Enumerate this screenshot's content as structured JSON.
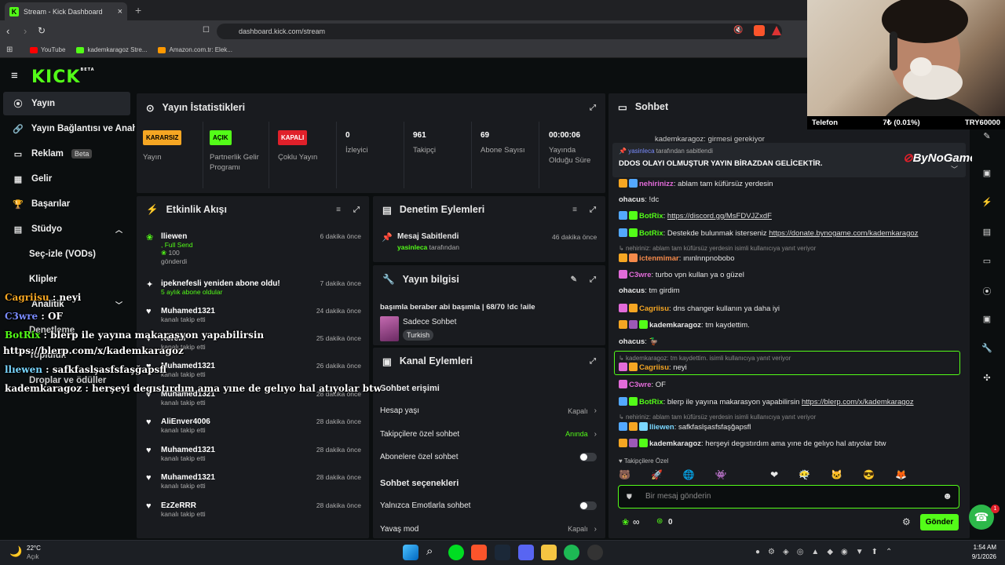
{
  "browser": {
    "tab_title": "Stream - Kick Dashboard",
    "url": "dashboard.kick.com/stream",
    "bookmarks": [
      {
        "label": "YouTube",
        "color": "#ff0000"
      },
      {
        "label": "kademkaragoz Stre...",
        "color": "#53fc18"
      },
      {
        "label": "Amazon.com.tr: Elek...",
        "color": "#ff9900"
      }
    ]
  },
  "kick": {
    "logo": "KICK",
    "logo_sup": "BETA"
  },
  "sidebar": {
    "items": [
      {
        "label": "Yayın",
        "icon": "radio-icon"
      },
      {
        "label": "Yayın Bağlantısı ve Anahtarı",
        "icon": "link-icon"
      },
      {
        "label": "Reklam",
        "icon": "ad-icon",
        "badge": "Beta"
      },
      {
        "label": "Gelir",
        "icon": "money-icon"
      },
      {
        "label": "Başarılar",
        "icon": "trophy-icon"
      },
      {
        "label": "Stüdyo",
        "icon": "studio-icon"
      }
    ],
    "studio_sub": [
      "Seç-izle (VODs)",
      "Klipler"
    ],
    "analytics": "Analitik",
    "hidden": [
      "Denetleme",
      "Topluluk",
      "Droplar ve ödüller"
    ]
  },
  "stats": {
    "title": "Yayın İstatistikleri",
    "cards": [
      {
        "badge": "KARARSIZ",
        "label": "Yayın",
        "color": "#f5a623",
        "text": "#000"
      },
      {
        "badge": "AÇIK",
        "label": "Partnerlik Gelir Programı",
        "color": "#53fc18",
        "text": "#000"
      },
      {
        "badge": "KAPALI",
        "label": "Çoklu Yayın",
        "color": "#e0202a",
        "text": "#fff"
      }
    ],
    "numbers": [
      {
        "value": "0",
        "label": "İzleyici"
      },
      {
        "value": "961",
        "label": "Takipçi"
      },
      {
        "value": "69",
        "label": "Abone Sayısı"
      },
      {
        "value": "00:00:06",
        "label": "Yayında Olduğu Süre"
      }
    ]
  },
  "activity": {
    "title": "Etkinlik Akışı",
    "events": [
      {
        "title": "lliewen",
        "sub": ", Full Send",
        "extra": "100",
        "extra2": "gönderdi",
        "time": "6 dakika önce",
        "icon": "kicks-icon"
      },
      {
        "title": "ipeknefesli yeniden abone oldu!",
        "sub": "5 aylık abone oldular",
        "time": "7 dakika önce",
        "icon": "star-icon"
      },
      {
        "title": "Muhamed1321",
        "sub": "kanalı takip etti",
        "time": "24 dakika önce",
        "icon": "heart-icon"
      },
      {
        "title": "Kerem",
        "sub": "kanalı takip etti",
        "time": "25 dakika önce",
        "icon": "heart-icon"
      },
      {
        "title": "Muhamed1321",
        "sub": "kanalı takip etti",
        "time": "26 dakika önce",
        "icon": "heart-icon"
      },
      {
        "title": "Muhamed1321",
        "sub": "kanalı takip etti",
        "time": "28 dakika önce",
        "icon": "heart-icon"
      },
      {
        "title": "AliEnver4006",
        "sub": "kanalı takip etti",
        "time": "28 dakika önce",
        "icon": "heart-icon"
      },
      {
        "title": "Muhamed1321",
        "sub": "kanalı takip etti",
        "time": "28 dakika önce",
        "icon": "heart-icon"
      },
      {
        "title": "Muhamed1321",
        "sub": "kanalı takip etti",
        "time": "28 dakika önce",
        "icon": "heart-icon"
      },
      {
        "title": "EzZeRRR",
        "sub": "kanalı takip etti",
        "time": "28 dakika önce",
        "icon": "heart-icon"
      }
    ]
  },
  "moderation": {
    "title": "Denetim Eylemleri",
    "event": {
      "title": "Mesaj Sabitlendi",
      "user": "yasinleca",
      "suffix": "tarafından",
      "time": "46 dakika önce"
    }
  },
  "streaminfo": {
    "title": "Yayın bilgisi",
    "stream_title": "başımla beraber abi başımla | 68/70 !dc !aile",
    "category": "Sadece Sohbet",
    "tag": "Turkish"
  },
  "channel": {
    "title": "Kanal Eylemleri",
    "section1": "Sohbet erişimi",
    "rows1": [
      {
        "label": "Hesap yaşı",
        "value": "Kapalı",
        "type": "link"
      },
      {
        "label": "Takipçilere özel sohbet",
        "value": "Anında",
        "type": "link"
      },
      {
        "label": "Abonelere özel sohbet",
        "value": "",
        "type": "toggle"
      }
    ],
    "section2": "Sohbet seçenekleri",
    "rows2": [
      {
        "label": "Yalnızca Emotlarla sohbet",
        "value": "",
        "type": "toggle"
      },
      {
        "label": "Yavaş mod",
        "value": "Kapalı",
        "type": "link"
      }
    ]
  },
  "chat": {
    "title": "Sohbet",
    "pinned": {
      "by": "yasinleca",
      "by_suffix": "tarafından sabitlendi",
      "text": "DDOS OLAYI OLMUŞTUR YAYIN BİRAZDAN GELİCEKTİR."
    },
    "top_partial": "kademkaragoz: girmesi gerekiyor",
    "messages": [
      {
        "user": "nehirinizz",
        "color": "#e26bd9",
        "text": ": ablam tam küfürsüz yerdesin"
      },
      {
        "user": "ohacus",
        "color": "#e8e8e8",
        "text": ": !dc"
      },
      {
        "user": "BotRix",
        "color": "#53fc18",
        "text": ": ",
        "link": "https://discord.gg/MsFDVJZxdF"
      },
      {
        "user": "BotRix",
        "color": "#53fc18",
        "text": ": Destekde bulunmak isterseniz ",
        "link": "https://donate.bynogame.com/kademkaragoz"
      },
      {
        "user": "ictenmimar",
        "color": "#f58a4b",
        "text": ": ınınlnnpnobobo"
      },
      {
        "user": "C3wre",
        "color": "#e26bd9",
        "text": ": turbo vpn kullan ya o güzel"
      },
      {
        "user": "ohacus",
        "color": "#e8e8e8",
        "text": ": tm girdim"
      },
      {
        "user": "Cagriisu",
        "color": "#f5a623",
        "text": ": dns changer kullanın ya daha iyi"
      },
      {
        "user": "kademkaragoz",
        "color": "#e8e8e8",
        "text": ": tm kaydettim."
      },
      {
        "user": "ohacus",
        "color": "#e8e8e8",
        "text": ": "
      },
      {
        "user": "Cagriisu",
        "color": "#f5a623",
        "text": ": neyi"
      },
      {
        "user": "C3wre",
        "color": "#e26bd9",
        "text": ": OF"
      },
      {
        "user": "BotRix",
        "color": "#53fc18",
        "text": ": blerp ile yayına makarasyon yapabilirsin ",
        "link": "https://blerp.com/x/kademkaragoz"
      },
      {
        "user": "lliewen",
        "color": "#7ad7ff",
        "text": ": safkfaslşasfsfaşğapsfl"
      },
      {
        "user": "kademkaragoz",
        "color": "#e8e8e8",
        "text": ": herşeyi degıstırdım ama yıne de gelıyo hal atıyolar btw"
      }
    ],
    "reply_notes": [
      "nehiriniz: ablam tam küfürsüz yerdesin isimli kullanıcıya yanıt veriyor",
      "kademkaragoz: tm kaydettim. isimli kullanıcıya yanıt veriyor",
      "nehiriniz: ablam tam küfürsüz yerdesin isimli kullanıcıya yanıt veriyor"
    ],
    "followers_only": "Takipçilere Özel",
    "input_placeholder": "Bir mesaj gönderin",
    "send": "Gönder",
    "infinity": "∞",
    "kicks": "0"
  },
  "webcam": {
    "phone_label": "Telefon",
    "change": "7₺ (0.01%)",
    "currency": "TRY60000"
  },
  "bynogame": "ByNoGame",
  "overlay": {
    "lines": [
      {
        "user": "Cagriisu",
        "text": " : neyi"
      },
      {
        "user": "C3wre",
        "text": " : OF"
      },
      {
        "user": "BotRix",
        "text": " : blerp ile yayına makarasyon yapabilirsin"
      },
      {
        "user": "",
        "text": "https://blerp.com/x/kademkaragoz"
      },
      {
        "user": "llıewen",
        "text": " : safkfaslşasfsfaşğapsfl"
      },
      {
        "user": "kademkaragoz",
        "text": " : herşeyi degıstırdım ama yıne de gelıyo hal atıyolar btw"
      }
    ]
  },
  "taskbar": {
    "weather": "22°C",
    "weather_sub": "Açık",
    "time": "1:54 AM",
    "date": "9/1/2026"
  },
  "support_badge": "1"
}
